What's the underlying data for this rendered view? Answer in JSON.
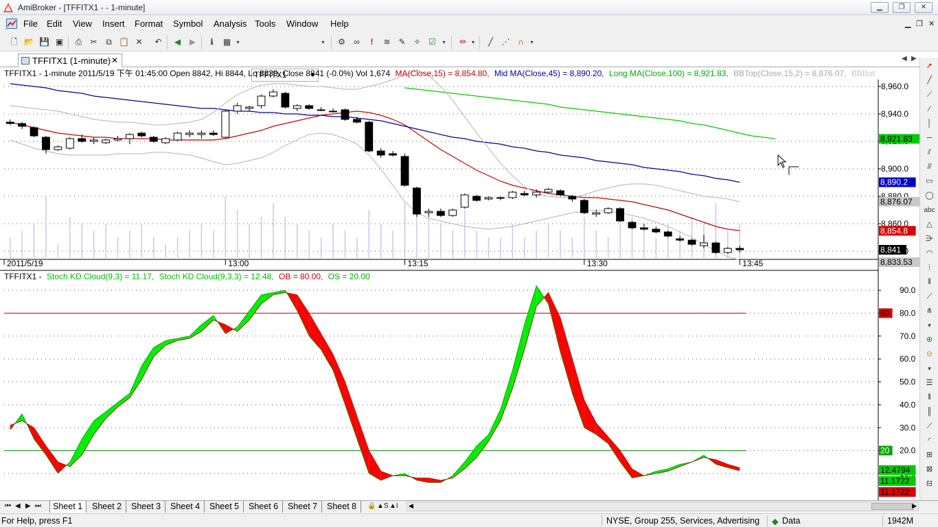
{
  "window": {
    "title": "AmiBroker - [TFFITX1 -  - 1-minute]",
    "controls": [
      "minimize",
      "restore",
      "close"
    ]
  },
  "menu": {
    "items": [
      "File",
      "Edit",
      "View",
      "Insert",
      "Format",
      "Symbol",
      "Analysis",
      "Tools",
      "Window",
      "Help"
    ],
    "mdi_controls": [
      "minimize",
      "restore",
      "close"
    ]
  },
  "toolbar": {
    "symbol": "TFFITX1",
    "left_icons": [
      "new-icon",
      "open-icon",
      "save-icon",
      "save-all-icon",
      "print-icon",
      "cut-icon",
      "copy-icon",
      "paste-icon",
      "delete-icon",
      "undo-icon",
      "back-icon",
      "forward-icon",
      "info-icon",
      "calendar-icon"
    ],
    "right_icons": [
      "gear-icon",
      "glasses-icon",
      "alert-icon",
      "scroll-icon",
      "tools-icon",
      "wand-icon",
      "check-icon",
      "pen-color-icon",
      "line-icon",
      "dotted-line-icon",
      "magnet-icon"
    ]
  },
  "document_tab": {
    "label": "TFFITX1 (1-minute)"
  },
  "price_pane": {
    "header": {
      "symbol_info": "TFFITX1 - 1-minute 2011/5/19 下午 01:45:00 Open 8842, Hi 8844, Lo 8839, Close 8841 (-0.0%) Vol 1,674",
      "ma15": "MA(Close,15) = 8,854.80,",
      "ma45": "Mid MA(Close,45) = 8,890.20,",
      "ma100": "Long MA(Close,100) = 8,921.83,",
      "bbtop": "BBTop(Close,15,2) = 8,876.07,",
      "bbbot": "BBBot("
    },
    "colors": {
      "ma15": "#cc0000",
      "ma45": "#000099",
      "ma100": "#00cc00",
      "bb": "#c0c0c0",
      "volume": "#c8c8e8"
    },
    "y_axis_ticks": [
      "8,960.0",
      "8,940.0",
      "8,920.0",
      "8,900.0",
      "8,880.0",
      "8,860.0",
      "8,840.0"
    ],
    "value_labels": [
      {
        "text": "8,921.83",
        "bg": "#00cc00",
        "fg": "#000000",
        "value": 8921.83
      },
      {
        "text": "8,890.2",
        "bg": "#0000cc",
        "fg": "#ffffff",
        "value": 8890.2
      },
      {
        "text": "8,876.07",
        "bg": "#c8c8c8",
        "fg": "#000000",
        "value": 8876.07
      },
      {
        "text": "8,854.8",
        "bg": "#dd0000",
        "fg": "#ffffff",
        "value": 8854.8
      },
      {
        "text": "8,841",
        "bg": "#000000",
        "fg": "#ffffff",
        "value": 8841
      },
      {
        "text": "8,833.53",
        "bg": "#c8c8c8",
        "fg": "#000000",
        "value": 8833.53
      }
    ],
    "x_axis_labels": [
      "2011/5/19",
      "13:00",
      "13:15",
      "13:30",
      "13:45"
    ]
  },
  "stoch_pane": {
    "header": {
      "symbol": "TFFITX1 -",
      "k": "Stoch KD Cloud(9,3) = 11.17,",
      "d": "Stoch KD Cloud(9,3,3) = 12.48,",
      "ob": "OB = 80.00,",
      "os": "OS = 20.00"
    },
    "y_axis_ticks": [
      "90.0",
      "80.0",
      "70.0",
      "60.0",
      "50.0",
      "40.0",
      "30.0",
      "20.0",
      "10.0"
    ],
    "value_labels": [
      {
        "text": "80",
        "bg": "#dd0000",
        "fg": "#000000",
        "value": 80
      },
      {
        "text": "20",
        "bg": "#00aa00",
        "fg": "#ffffff",
        "value": 20
      },
      {
        "text": "12.4794",
        "bg": "#00cc00",
        "fg": "#000000",
        "value": 12.4794
      },
      {
        "text": "11.1722",
        "bg": "#00cc00",
        "fg": "#000000",
        "value": 11.1722
      },
      {
        "text": "11.1722",
        "bg": "#dd0000",
        "fg": "#000000",
        "value": 11.1722
      }
    ]
  },
  "chart_data": [
    {
      "type": "candlestick",
      "title": "TFFITX1 - 1-minute 2011/5/19",
      "x_labels": [
        "2011/5/19",
        "13:00",
        "13:15",
        "13:30",
        "13:45"
      ],
      "ylim": [
        8835,
        8965
      ],
      "candles": [
        {
          "o": 8934,
          "h": 8936,
          "l": 8932,
          "c": 8933
        },
        {
          "o": 8933,
          "h": 8934,
          "l": 8929,
          "c": 8931
        },
        {
          "o": 8930,
          "h": 8931,
          "l": 8923,
          "c": 8924
        },
        {
          "o": 8923,
          "h": 8924,
          "l": 8911,
          "c": 8914
        },
        {
          "o": 8914,
          "h": 8917,
          "l": 8913,
          "c": 8916
        },
        {
          "o": 8915,
          "h": 8923,
          "l": 8914,
          "c": 8922
        },
        {
          "o": 8922,
          "h": 8925,
          "l": 8919,
          "c": 8920
        },
        {
          "o": 8920,
          "h": 8923,
          "l": 8918,
          "c": 8921
        },
        {
          "o": 8919,
          "h": 8922,
          "l": 8918,
          "c": 8921
        },
        {
          "o": 8921,
          "h": 8924,
          "l": 8920,
          "c": 8922
        },
        {
          "o": 8922,
          "h": 8926,
          "l": 8918,
          "c": 8925
        },
        {
          "o": 8926,
          "h": 8927,
          "l": 8923,
          "c": 8924
        },
        {
          "o": 8923,
          "h": 8924,
          "l": 8919,
          "c": 8920
        },
        {
          "o": 8919,
          "h": 8923,
          "l": 8918,
          "c": 8922
        },
        {
          "o": 8921,
          "h": 8927,
          "l": 8920,
          "c": 8926
        },
        {
          "o": 8925,
          "h": 8928,
          "l": 8923,
          "c": 8926
        },
        {
          "o": 8925,
          "h": 8928,
          "l": 8922,
          "c": 8926
        },
        {
          "o": 8926,
          "h": 8928,
          "l": 8924,
          "c": 8925
        },
        {
          "o": 8923,
          "h": 8943,
          "l": 8922,
          "c": 8942
        },
        {
          "o": 8942,
          "h": 8948,
          "l": 8940,
          "c": 8946
        },
        {
          "o": 8944,
          "h": 8946,
          "l": 8942,
          "c": 8945
        },
        {
          "o": 8946,
          "h": 8954,
          "l": 8944,
          "c": 8953
        },
        {
          "o": 8953,
          "h": 8958,
          "l": 8952,
          "c": 8956
        },
        {
          "o": 8955,
          "h": 8956,
          "l": 8944,
          "c": 8945
        },
        {
          "o": 8944,
          "h": 8947,
          "l": 8942,
          "c": 8946
        },
        {
          "o": 8946,
          "h": 8947,
          "l": 8943,
          "c": 8944
        },
        {
          "o": 8943,
          "h": 8945,
          "l": 8942,
          "c": 8943
        },
        {
          "o": 8942,
          "h": 8944,
          "l": 8941,
          "c": 8942
        },
        {
          "o": 8943,
          "h": 8944,
          "l": 8935,
          "c": 8936
        },
        {
          "o": 8936,
          "h": 8938,
          "l": 8933,
          "c": 8934
        },
        {
          "o": 8934,
          "h": 8935,
          "l": 8912,
          "c": 8913
        },
        {
          "o": 8913,
          "h": 8915,
          "l": 8908,
          "c": 8910
        },
        {
          "o": 8911,
          "h": 8913,
          "l": 8909,
          "c": 8910
        },
        {
          "o": 8909,
          "h": 8911,
          "l": 8887,
          "c": 8888
        },
        {
          "o": 8886,
          "h": 8887,
          "l": 8865,
          "c": 8867
        },
        {
          "o": 8868,
          "h": 8871,
          "l": 8865,
          "c": 8869
        },
        {
          "o": 8869,
          "h": 8871,
          "l": 8865,
          "c": 8866
        },
        {
          "o": 8866,
          "h": 8871,
          "l": 8865,
          "c": 8870
        },
        {
          "o": 8872,
          "h": 8882,
          "l": 8871,
          "c": 8881
        },
        {
          "o": 8880,
          "h": 8881,
          "l": 8876,
          "c": 8877
        },
        {
          "o": 8878,
          "h": 8880,
          "l": 8877,
          "c": 8879
        },
        {
          "o": 8879,
          "h": 8880,
          "l": 8877,
          "c": 8879
        },
        {
          "o": 8879,
          "h": 8884,
          "l": 8878,
          "c": 8883
        },
        {
          "o": 8882,
          "h": 8884,
          "l": 8880,
          "c": 8881
        },
        {
          "o": 8881,
          "h": 8885,
          "l": 8879,
          "c": 8883
        },
        {
          "o": 8883,
          "h": 8886,
          "l": 8882,
          "c": 8885
        },
        {
          "o": 8884,
          "h": 8885,
          "l": 8880,
          "c": 8881
        },
        {
          "o": 8880,
          "h": 8881,
          "l": 8876,
          "c": 8878
        },
        {
          "o": 8877,
          "h": 8878,
          "l": 8867,
          "c": 8868
        },
        {
          "o": 8867,
          "h": 8870,
          "l": 8865,
          "c": 8868
        },
        {
          "o": 8868,
          "h": 8872,
          "l": 8867,
          "c": 8871
        },
        {
          "o": 8871,
          "h": 8872,
          "l": 8861,
          "c": 8862
        },
        {
          "o": 8861,
          "h": 8862,
          "l": 8856,
          "c": 8857
        },
        {
          "o": 8857,
          "h": 8860,
          "l": 8855,
          "c": 8856
        },
        {
          "o": 8856,
          "h": 8858,
          "l": 8853,
          "c": 8854
        },
        {
          "o": 8854,
          "h": 8855,
          "l": 8850,
          "c": 8851
        },
        {
          "o": 8849,
          "h": 8851,
          "l": 8847,
          "c": 8848
        },
        {
          "o": 8848,
          "h": 8849,
          "l": 8844,
          "c": 8845
        },
        {
          "o": 8844,
          "h": 8852,
          "l": 8842,
          "c": 8846
        },
        {
          "o": 8846,
          "h": 8847,
          "l": 8838,
          "c": 8839
        },
        {
          "o": 8839,
          "h": 8843,
          "l": 8838,
          "c": 8842
        },
        {
          "o": 8842,
          "h": 8844,
          "l": 8839,
          "c": 8841
        }
      ],
      "series": [
        {
          "name": "MA(Close,15)",
          "color": "#cc0000",
          "values": [
            8934,
            8932,
            8930,
            8928,
            8926,
            8925,
            8924,
            8923,
            8923,
            8922,
            8922,
            8922,
            8922,
            8921,
            8921,
            8921,
            8921,
            8921,
            8922,
            8924,
            8926,
            8928,
            8931,
            8933,
            8935,
            8937,
            8939,
            8940,
            8941,
            8942,
            8941,
            8939,
            8936,
            8932,
            8926,
            8920,
            8914,
            8909,
            8904,
            8899,
            8895,
            8891,
            8888,
            8886,
            8884,
            8882,
            8881,
            8880,
            8879,
            8879,
            8878,
            8877,
            8876,
            8874,
            8872,
            8870,
            8867,
            8864,
            8861,
            8858,
            8856,
            8855
          ]
        },
        {
          "name": "Mid MA(Close,45)",
          "color": "#000099",
          "values": [
            8962,
            8961,
            8960,
            8959,
            8957,
            8956,
            8955,
            8953,
            8952,
            8951,
            8950,
            8949,
            8948,
            8947,
            8946,
            8945,
            8944,
            8944,
            8943,
            8942,
            8942,
            8941,
            8941,
            8940,
            8940,
            8939,
            8939,
            8938,
            8938,
            8937,
            8936,
            8935,
            8933,
            8931,
            8929,
            8927,
            8925,
            8923,
            8922,
            8920,
            8919,
            8918,
            8916,
            8915,
            8913,
            8912,
            8910,
            8909,
            8908,
            8906,
            8905,
            8904,
            8903,
            8901,
            8900,
            8899,
            8898,
            8896,
            8895,
            8893,
            8892,
            8890.2
          ]
        },
        {
          "name": "Long MA(Close,100)",
          "color": "#00cc00",
          "start_index": 33,
          "values": [
            8959,
            8958,
            8957,
            8956,
            8955,
            8954,
            8953,
            8952,
            8951,
            8950,
            8949,
            8948,
            8947,
            8945,
            8944,
            8943,
            8942,
            8941,
            8940,
            8939,
            8938,
            8937,
            8936,
            8935,
            8933,
            8932,
            8930,
            8928,
            8926,
            8924,
            8923,
            8921.83
          ]
        },
        {
          "name": "BBTop(Close,15,2)",
          "color": "#c0c0c0",
          "values": [
            8946,
            8945,
            8944,
            8943,
            8942,
            8940,
            8938,
            8936,
            8935,
            8934,
            8934,
            8933,
            8932,
            8932,
            8933,
            8934,
            8936,
            8941,
            8948,
            8954,
            8958,
            8961,
            8962,
            8962,
            8961,
            8960,
            8960,
            8959,
            8958,
            8958,
            8960,
            8962,
            8965,
            8968,
            8972,
            8968,
            8960,
            8950,
            8938,
            8926,
            8915,
            8904,
            8895,
            8887,
            8882,
            8880,
            8879,
            8879,
            8881,
            8884,
            8886,
            8888,
            8889,
            8889,
            8888,
            8886,
            8884,
            8882,
            8880,
            8879,
            8878,
            8876.07
          ]
        },
        {
          "name": "BBBot",
          "color": "#c0c0c0",
          "values": [
            8921,
            8918,
            8915,
            8913,
            8911,
            8910,
            8910,
            8910,
            8910,
            8911,
            8911,
            8911,
            8912,
            8912,
            8911,
            8910,
            8908,
            8905,
            8903,
            8904,
            8906,
            8908,
            8912,
            8917,
            8921,
            8925,
            8926,
            8925,
            8922,
            8918,
            8910,
            8900,
            8888,
            8876,
            8868,
            8864,
            8862,
            8860,
            8858,
            8857,
            8856,
            8857,
            8858,
            8860,
            8862,
            8864,
            8866,
            8868,
            8869,
            8870,
            8869,
            8868,
            8866,
            8864,
            8861,
            8858,
            8854,
            8850,
            8845,
            8840,
            8836,
            8833.53
          ]
        }
      ],
      "volume_pattern": [
        0.3,
        0.4,
        0.5,
        0.9,
        0.2,
        0.6,
        0.5,
        0.4,
        0.5,
        0.3,
        0.4,
        0.5,
        0.3,
        0.2,
        0.3,
        0.4,
        0.5,
        0.4,
        0.9,
        0.7,
        0.5,
        0.6,
        0.8,
        0.6,
        0.5,
        0.4,
        0.3,
        0.5,
        0.4,
        0.3,
        0.7,
        0.5,
        0.4,
        0.8,
        0.9,
        0.6,
        0.5,
        0.4,
        0.7,
        0.4,
        0.3,
        0.3,
        0.5,
        0.3,
        0.4,
        0.5,
        0.4,
        0.3,
        0.6,
        0.4,
        0.3,
        0.5,
        0.6,
        0.4,
        0.3,
        0.5,
        0.4,
        0.6,
        0.5,
        0.8,
        0.4,
        0.5
      ]
    },
    {
      "type": "area",
      "title": "Stoch KD Cloud",
      "ylim": [
        0,
        100
      ],
      "y_ticks": [
        90,
        80,
        70,
        60,
        50,
        40,
        30,
        20,
        10
      ],
      "ob": 80,
      "os": 20,
      "series": [
        {
          "name": "Stoch KD Cloud(9,3)",
          "color": "#00ee00",
          "values": [
            29,
            36,
            25,
            18,
            10,
            15,
            25,
            33,
            37,
            41,
            45,
            57,
            65,
            68,
            69,
            70,
            75,
            79,
            71,
            74,
            81,
            88,
            89,
            90,
            81,
            70,
            64,
            55,
            40,
            25,
            10,
            7,
            9,
            10,
            7,
            6,
            6,
            9,
            15,
            22,
            27,
            38,
            55,
            75,
            92,
            84,
            63,
            45,
            30,
            27,
            23,
            15,
            8,
            9,
            11,
            12,
            14,
            15,
            18,
            14,
            12.48,
            11.17
          ]
        },
        {
          "name": "Stoch KD Cloud(9,3,3)",
          "color": "#ff0000",
          "values": [
            31,
            33,
            30,
            22,
            15,
            13,
            18,
            27,
            34,
            39,
            43,
            51,
            61,
            66,
            68,
            69,
            72,
            77,
            75,
            72,
            77,
            84,
            88,
            89,
            88,
            80,
            71,
            62,
            50,
            35,
            20,
            11,
            9,
            9,
            8,
            8,
            7,
            8,
            12,
            17,
            24,
            33,
            47,
            64,
            83,
            89,
            78,
            60,
            42,
            32,
            26,
            20,
            12,
            9,
            10,
            11,
            13,
            15,
            17,
            16,
            14,
            12.48
          ]
        }
      ]
    }
  ],
  "sheets": {
    "tabs": [
      "Sheet 1",
      "Sheet 2",
      "Sheet 3",
      "Sheet 4",
      "Sheet 5",
      "Sheet 6",
      "Sheet 7",
      "Sheet 8"
    ],
    "active": "Sheet 1"
  },
  "status": {
    "help": "For Help, press F1",
    "info": "NYSE, Group 255, Services, Advertising",
    "data": "Data",
    "memory": "1942M"
  }
}
